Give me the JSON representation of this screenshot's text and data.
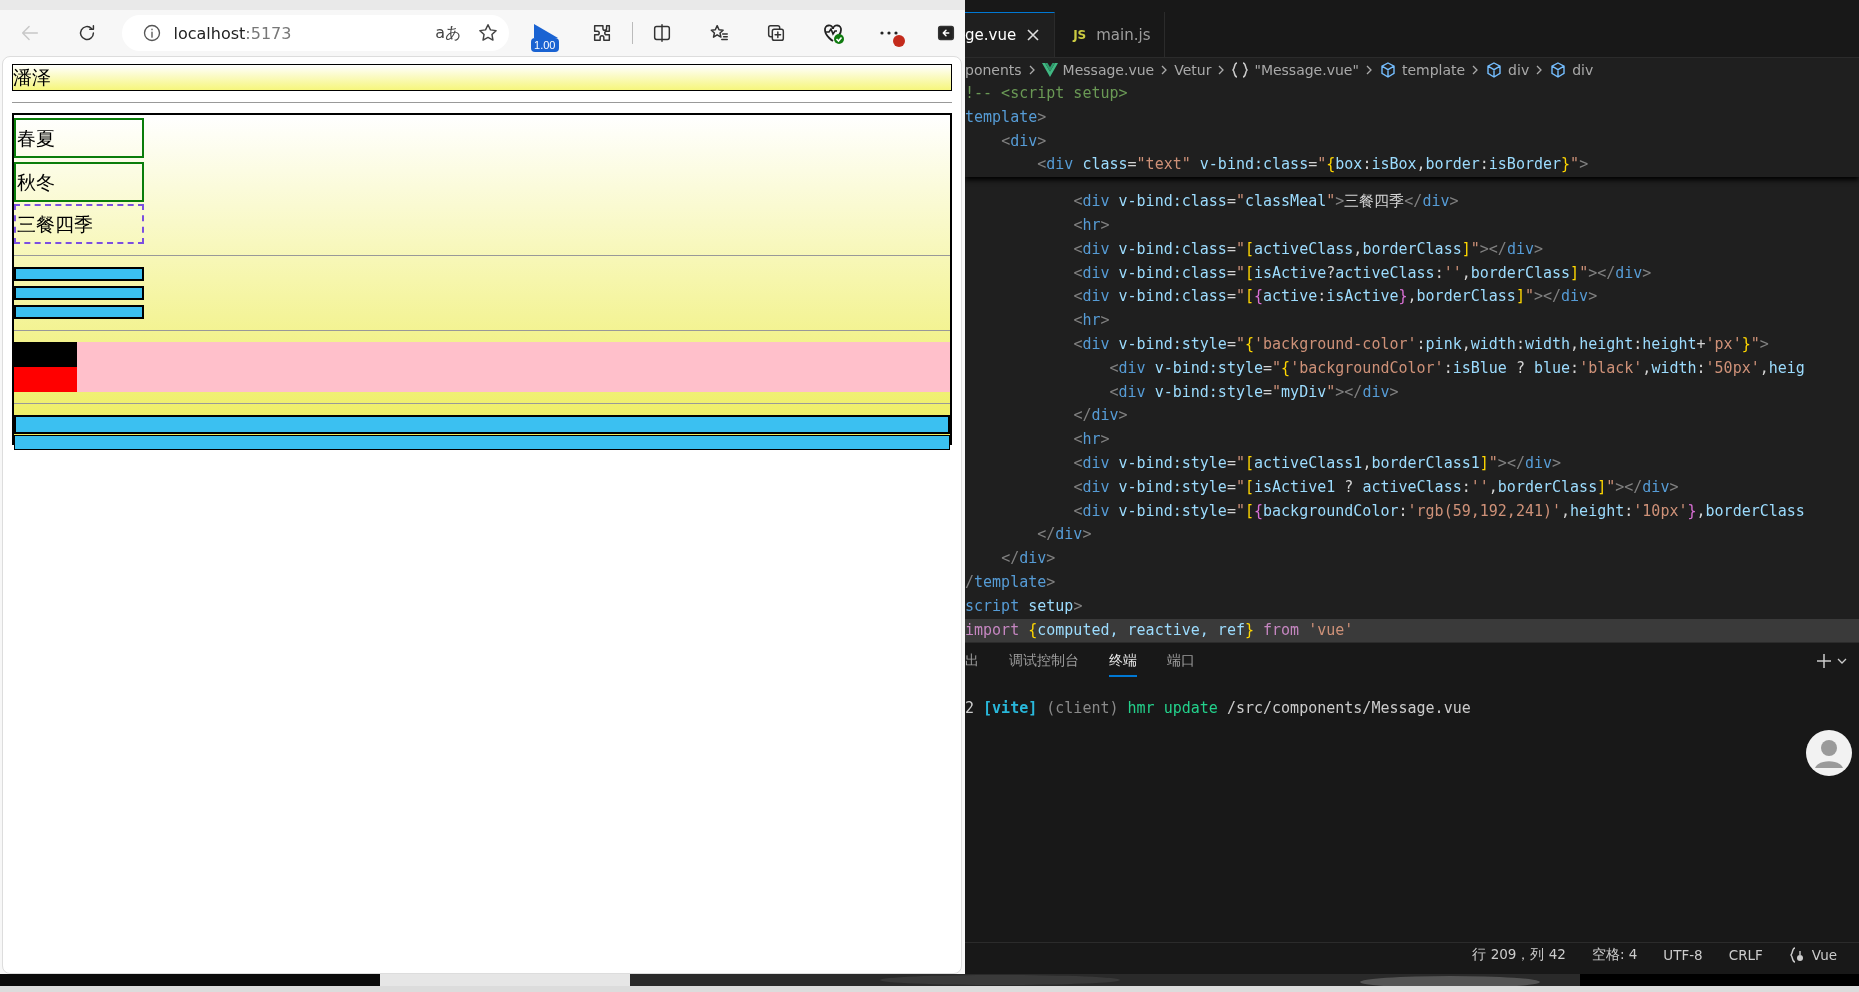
{
  "browser": {
    "nav": [
      {
        "kind": "back",
        "disabled": true
      },
      {
        "kind": "reload",
        "disabled": false
      }
    ],
    "address": {
      "host": "localhost",
      "port": ":5173"
    },
    "read_aloud": "aあ",
    "extension_badge": "1.00",
    "page": {
      "banner": "潘泽",
      "items": [
        {
          "text": "春夏",
          "kind": "solid"
        },
        {
          "text": "秋冬",
          "kind": "solid"
        },
        {
          "text": "三餐四季",
          "kind": "dashed"
        }
      ],
      "small_bars": [
        {
          "kind": "bordered"
        },
        {
          "kind": "bordered"
        },
        {
          "kind": "bordered"
        }
      ],
      "color_blocks": [
        {
          "color": "#000000"
        },
        {
          "color": "#ff0000"
        }
      ],
      "wide_bars": [
        {
          "kind": "bordered"
        },
        {
          "kind": "thin"
        }
      ]
    }
  },
  "editor": {
    "tabs": [
      {
        "label": "ge.vue",
        "selected": true
      },
      {
        "label": "main.js",
        "selected": false,
        "badge": "JS"
      }
    ],
    "breadcrumb": [
      {
        "text": "ponents",
        "kind": "plain"
      },
      {
        "text": "Message.vue",
        "kind": "vue"
      },
      {
        "text": "Vetur",
        "kind": "plain"
      },
      {
        "text": "\"Message.vue\"",
        "kind": "braces"
      },
      {
        "text": "template",
        "kind": "element"
      },
      {
        "text": "div",
        "kind": "element"
      },
      {
        "text": "div",
        "kind": "element"
      }
    ],
    "sticky_lines": [
      "!-- <script setup>",
      "template>",
      "    <div>",
      "        <div class=\"text\" v-bind:class=\"{box:isBox,border:isBorder}\">"
    ],
    "lines": [
      "            <div v-bind:class=\"classMeal\">三餐四季</div>",
      "            <hr>",
      "            <div v-bind:class=\"[activeClass,borderClass]\"></div>",
      "            <div v-bind:class=\"[isActive?activeClass:'',borderClass]\"></div>",
      "            <div v-bind:class=\"[{active:isActive},borderClass]\"></div>",
      "            <hr>",
      "            <div v-bind:style=\"{'background-color':pink,width:width,height:height+'px'}\">",
      "                <div v-bind:style=\"{'backgroundColor':isBlue ? blue:'black',width:'50px',heig",
      "                <div v-bind:style=\"myDiv\"></div>",
      "            </div>",
      "            <hr>",
      "            <div v-bind:style=\"[activeClass1,borderClass1]\"></div>",
      "            <div v-bind:style=\"[isActive1 ? activeClass:'',borderClass]\"></div>",
      "            <div v-bind:style=\"[{backgroundColor:'rgb(59,192,241)',height:'10px'},borderClass",
      "        </div>",
      "    </div>",
      "/template>",
      "script setup>"
    ],
    "current_line": [
      {
        "text": "import ",
        "kind": "keyword"
      },
      {
        "text": "{",
        "kind": "bracket"
      },
      {
        "text": "computed, reactive, ref",
        "kind": "name"
      },
      {
        "text": "}",
        "kind": "bracket"
      },
      {
        "text": " from ",
        "kind": "keyword"
      },
      {
        "text": "'vue'",
        "kind": "string"
      }
    ],
    "panel": {
      "tabs": [
        {
          "label": "出",
          "selected": false
        },
        {
          "label": "调试控制台",
          "selected": false
        },
        {
          "label": "终端",
          "selected": true
        },
        {
          "label": "端口",
          "selected": false
        }
      ],
      "terminal_lines": [
        [
          {
            "text": "2 ",
            "kind": "plain"
          },
          {
            "text": "[vite]",
            "kind": "tag"
          },
          {
            "text": " (client) ",
            "kind": "dim"
          },
          {
            "text": "hmr update",
            "kind": "ok"
          },
          {
            "text": " /src/components/Message.vue",
            "kind": "plain"
          }
        ]
      ]
    },
    "status_bar": [
      {
        "text": "行 209，列 42",
        "kind": "plain"
      },
      {
        "text": "空格: 4",
        "kind": "plain"
      },
      {
        "text": "UTF-8",
        "kind": "plain"
      },
      {
        "text": "CRLF",
        "kind": "plain"
      },
      {
        "text": "Vue",
        "kind": "language"
      }
    ]
  }
}
